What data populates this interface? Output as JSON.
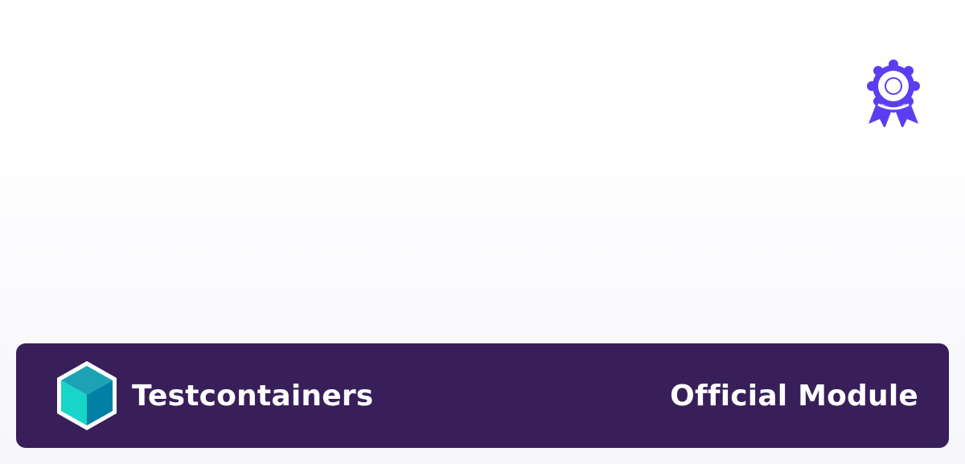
{
  "badge": {
    "icon": "award-ribbon-icon",
    "color": "#5b3ef2"
  },
  "footer": {
    "background_color": "#381f5a",
    "logo_icon": "testcontainers-cube-icon",
    "brand_name": "Testcontainers",
    "label": "Official Module"
  }
}
